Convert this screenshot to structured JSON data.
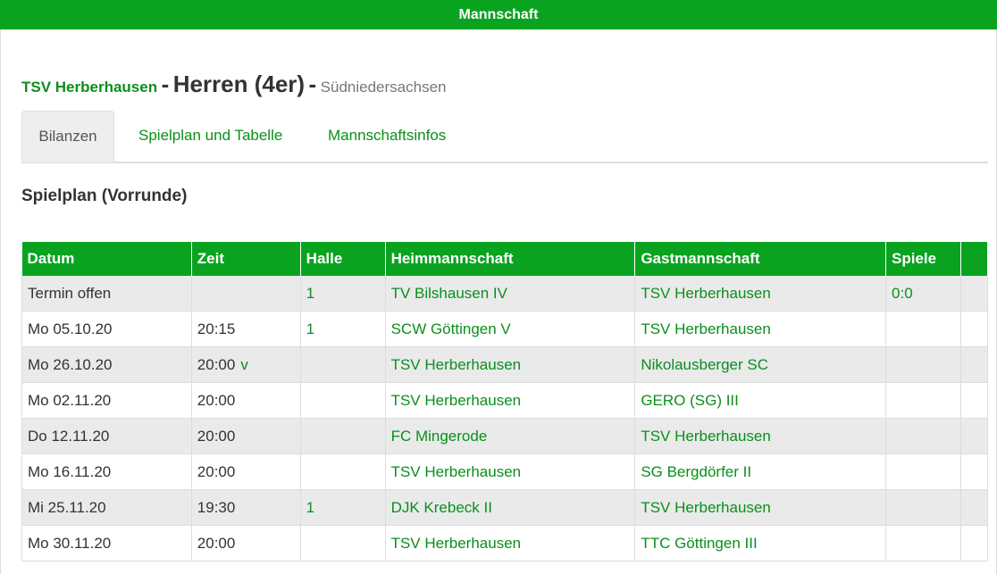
{
  "topbar": {
    "title": "Mannschaft"
  },
  "heading": {
    "club": "TSV Herberhausen",
    "separator1": "-",
    "team": "Herren (4er)",
    "separator2": "-",
    "league": "Südniedersachsen"
  },
  "tabs": [
    {
      "label": "Bilanzen",
      "active": true
    },
    {
      "label": "Spielplan und Tabelle",
      "active": false
    },
    {
      "label": "Mannschaftsinfos",
      "active": false
    }
  ],
  "section_title": "Spielplan (Vorrunde)",
  "table": {
    "headers": [
      "Datum",
      "Zeit",
      "Halle",
      "Heimmannschaft",
      "Gastmannschaft",
      "Spiele",
      ""
    ],
    "rows": [
      {
        "datum": "Termin offen",
        "zeit": "",
        "zeit_extra": "",
        "halle": "1",
        "heim": "TV Bilshausen IV",
        "gast": "TSV Herberhausen",
        "spiele": "0:0"
      },
      {
        "datum": "Mo 05.10.20",
        "zeit": "20:15",
        "zeit_extra": "",
        "halle": "1",
        "heim": "SCW Göttingen V",
        "gast": "TSV Herberhausen",
        "spiele": ""
      },
      {
        "datum": "Mo 26.10.20",
        "zeit": "20:00",
        "zeit_extra": "v",
        "halle": "",
        "heim": "TSV Herberhausen",
        "gast": "Nikolausberger SC",
        "spiele": ""
      },
      {
        "datum": "Mo 02.11.20",
        "zeit": "20:00",
        "zeit_extra": "",
        "halle": "",
        "heim": "TSV Herberhausen",
        "gast": "GERO (SG) III",
        "spiele": ""
      },
      {
        "datum": "Do 12.11.20",
        "zeit": "20:00",
        "zeit_extra": "",
        "halle": "",
        "heim": "FC Mingerode",
        "gast": "TSV Herberhausen",
        "spiele": ""
      },
      {
        "datum": "Mo 16.11.20",
        "zeit": "20:00",
        "zeit_extra": "",
        "halle": "",
        "heim": "TSV Herberhausen",
        "gast": "SG Bergdörfer II",
        "spiele": ""
      },
      {
        "datum": "Mi 25.11.20",
        "zeit": "19:30",
        "zeit_extra": "",
        "halle": "1",
        "heim": "DJK Krebeck II",
        "gast": "TSV Herberhausen",
        "spiele": ""
      },
      {
        "datum": "Mo 30.11.20",
        "zeit": "20:00",
        "zeit_extra": "",
        "halle": "",
        "heim": "TSV Herberhausen",
        "gast": "TTC Göttingen III",
        "spiele": ""
      }
    ]
  },
  "colors": {
    "accent": "#0aa320",
    "link": "#0a8f1c",
    "stripe": "#eaeaea"
  }
}
